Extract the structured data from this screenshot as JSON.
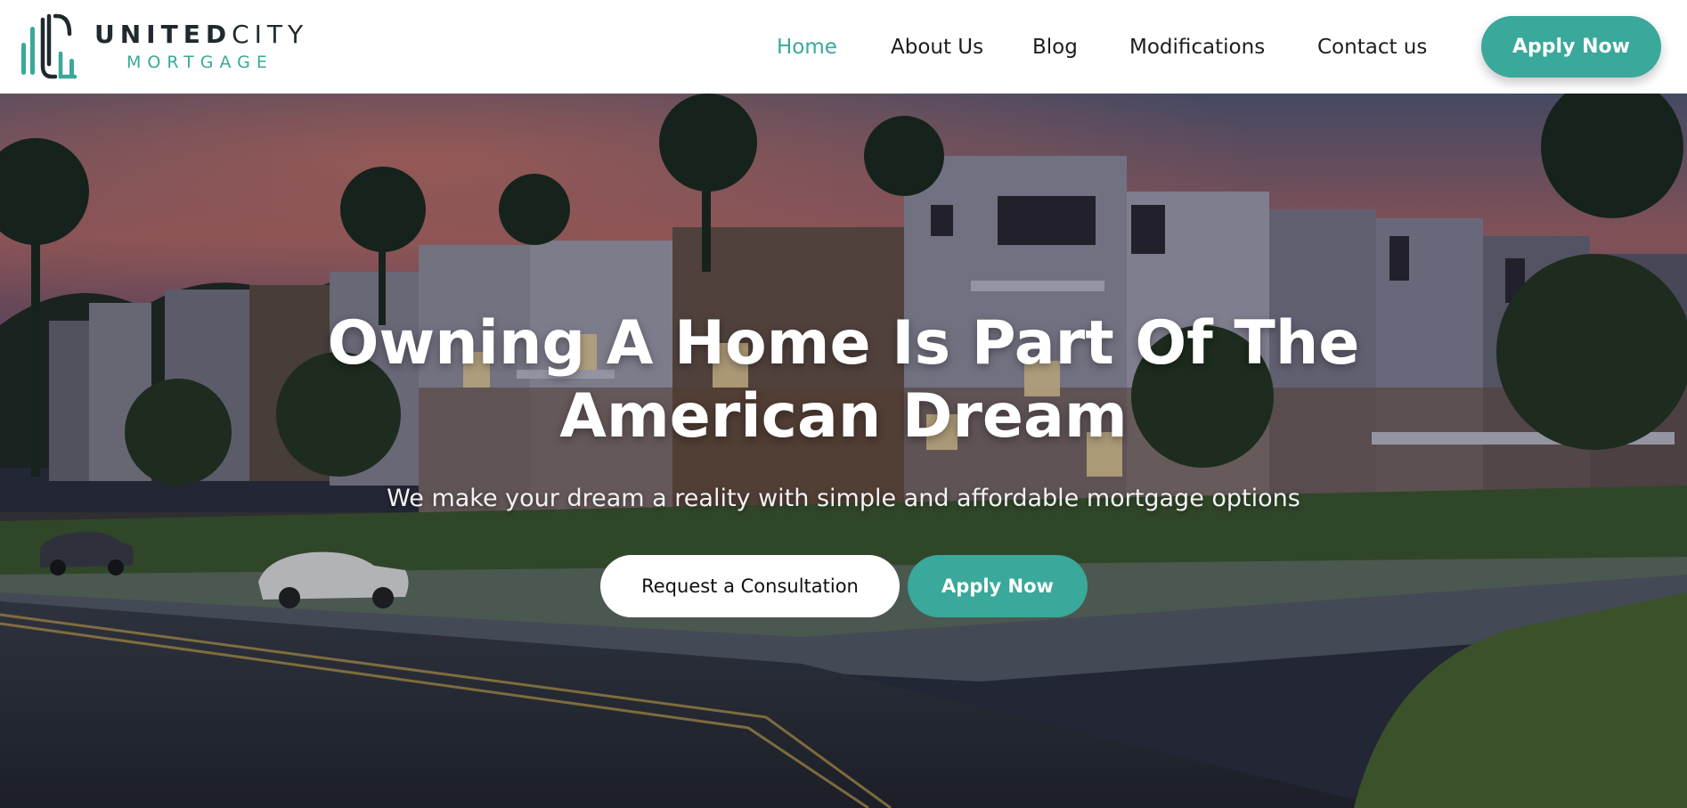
{
  "brand": {
    "name_primary": "UNITED",
    "name_secondary": "CITY",
    "tagline": "MORTGAGE",
    "accent_color": "#3aa89a",
    "logo_icon": "uc-monogram-icon"
  },
  "nav": {
    "items": [
      {
        "label": "Home",
        "active": true
      },
      {
        "label": "About Us",
        "active": false
      },
      {
        "label": "Blog",
        "active": false
      },
      {
        "label": "Modifications",
        "active": false
      },
      {
        "label": "Contact us",
        "active": false
      }
    ],
    "cta_label": "Apply Now"
  },
  "hero": {
    "title_line1": "Owning A Home Is Part Of The",
    "title_line2": "American Dream",
    "subtitle": "We make your dream a reality with simple and affordable mortgage options",
    "primary_button": "Request a Consultation",
    "secondary_button": "Apply Now",
    "background": "townhouses-at-dusk-photo"
  }
}
